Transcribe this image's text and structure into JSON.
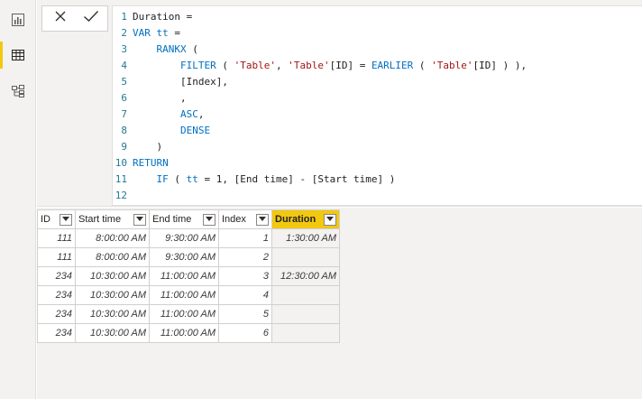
{
  "rail": {
    "items": [
      {
        "name": "report-view",
        "icon": "bar-chart-icon"
      },
      {
        "name": "data-view",
        "icon": "table-icon",
        "active": true
      },
      {
        "name": "model-view",
        "icon": "model-icon"
      }
    ]
  },
  "formula_bar": {
    "cancel_icon": "close-icon",
    "commit_icon": "checkmark-icon",
    "lines": [
      {
        "n": "1",
        "text": "Duration ="
      },
      {
        "n": "2",
        "text": "VAR tt ="
      },
      {
        "n": "3",
        "text": "    RANKX ("
      },
      {
        "n": "4",
        "text": "        FILTER ( 'Table', 'Table'[ID] = EARLIER ( 'Table'[ID] ) ),"
      },
      {
        "n": "5",
        "text": "        [Index],"
      },
      {
        "n": "6",
        "text": "        ,"
      },
      {
        "n": "7",
        "text": "        ASC,"
      },
      {
        "n": "8",
        "text": "        DENSE"
      },
      {
        "n": "9",
        "text": "    )"
      },
      {
        "n": "10",
        "text": "RETURN"
      },
      {
        "n": "11",
        "text": "    IF ( tt = 1, [End time] - [Start time] )"
      },
      {
        "n": "12",
        "text": ""
      }
    ]
  },
  "table": {
    "columns": [
      "ID",
      "Start time",
      "End time",
      "Index",
      "Duration"
    ],
    "active_column": "Duration",
    "rows": [
      [
        "111",
        "8:00:00 AM",
        "9:30:00 AM",
        "1",
        "1:30:00 AM"
      ],
      [
        "111",
        "8:00:00 AM",
        "9:30:00 AM",
        "2",
        ""
      ],
      [
        "234",
        "10:30:00 AM",
        "11:00:00 AM",
        "3",
        "12:30:00 AM"
      ],
      [
        "234",
        "10:30:00 AM",
        "11:00:00 AM",
        "4",
        ""
      ],
      [
        "234",
        "10:30:00 AM",
        "11:00:00 AM",
        "5",
        ""
      ],
      [
        "234",
        "10:30:00 AM",
        "11:00:00 AM",
        "6",
        ""
      ]
    ]
  },
  "colors": {
    "accent": "#f2c811",
    "keyword": "#0070c1",
    "string": "#a31515",
    "line_number": "#237893"
  }
}
